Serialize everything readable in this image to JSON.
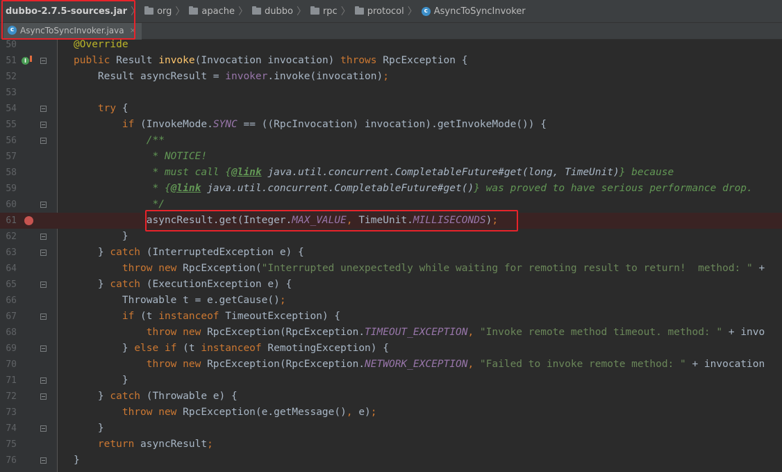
{
  "breadcrumb": {
    "items": [
      "dubbo-2.7.5-sources.jar",
      "org",
      "apache",
      "dubbo",
      "rpc",
      "protocol",
      "AsyncToSyncInvoker"
    ],
    "icons": [
      "none",
      "folder-icon",
      "folder-icon",
      "folder-icon",
      "folder-icon",
      "folder-icon",
      "class-icon"
    ]
  },
  "tab": {
    "label": "AsyncToSyncInvoker.java",
    "close": "×",
    "icon": "class-icon"
  },
  "colors": {
    "background": "#2b2b2b",
    "keyword": "#cc7832",
    "string": "#6a8759",
    "comment": "#629755",
    "field": "#9876aa",
    "method": "#ffc66d",
    "highlight_box": "#e8232a",
    "breakpoint": "#c75450"
  },
  "editor": {
    "lines": [
      {
        "n": "50",
        "html": "<span class=\"a\">@Override</span>",
        "fold": false,
        "bp": false,
        "override": false
      },
      {
        "n": "51",
        "html": "<span class=\"k\">public</span> Result <span class=\"fn\">invoke</span>(Invocation invocation) <span class=\"k\">throws</span> RpcException {",
        "fold": true,
        "bp": false,
        "override": true
      },
      {
        "n": "52",
        "html": "    Result asyncResult = <span class=\"fld\">invoker</span>.invoke(invocation)<span class=\"k\">;</span>",
        "fold": false,
        "bp": false,
        "override": false
      },
      {
        "n": "53",
        "html": "",
        "fold": false,
        "bp": false,
        "override": false
      },
      {
        "n": "54",
        "html": "    <span class=\"k\">try</span> {",
        "fold": true,
        "bp": false,
        "override": false
      },
      {
        "n": "55",
        "html": "        <span class=\"k\">if</span> (InvokeMode.<span class=\"st\">SYNC</span> == ((RpcInvocation) invocation).getInvokeMode()) {",
        "fold": true,
        "bp": false,
        "override": false
      },
      {
        "n": "56",
        "html": "            <span class=\"c\">/**</span>",
        "fold": true,
        "bp": false,
        "override": false
      },
      {
        "n": "57",
        "html": "<span class=\"c\">             * NOTICE!</span>",
        "fold": false,
        "bp": false,
        "override": false
      },
      {
        "n": "58",
        "html": "<span class=\"c\">             * must call {</span><span class=\"ct\">@link</span><span class=\"cr\"> java.util.concurrent.CompletableFuture#get(long, TimeUnit)</span><span class=\"c\">} because</span>",
        "fold": false,
        "bp": false,
        "override": false
      },
      {
        "n": "59",
        "html": "<span class=\"c\">             * {</span><span class=\"ct\">@link</span><span class=\"cr\"> java.util.concurrent.CompletableFuture#get()</span><span class=\"c\">} was proved to have serious performance drop.</span>",
        "fold": false,
        "bp": false,
        "override": false
      },
      {
        "n": "60",
        "html": "<span class=\"c\">             */</span>",
        "fold": true,
        "bp": false,
        "override": false
      },
      {
        "n": "61",
        "html": "            asyncResult.get(Integer.<span class=\"st\">MAX_VALUE</span><span class=\"k\">,</span> TimeUnit.<span class=\"st\">MILLISECONDS</span>)<span class=\"k\">;</span>",
        "fold": false,
        "bp": true,
        "override": false
      },
      {
        "n": "62",
        "html": "        }",
        "fold": true,
        "bp": false,
        "override": false
      },
      {
        "n": "63",
        "html": "    } <span class=\"k\">catch</span> (InterruptedException e) {",
        "fold": true,
        "bp": false,
        "override": false
      },
      {
        "n": "64",
        "html": "        <span class=\"k\">throw new</span> RpcException(<span class=\"s\">\"Interrupted unexpectedly while waiting for remoting result to return!  method: \"</span> +",
        "fold": false,
        "bp": false,
        "override": false
      },
      {
        "n": "65",
        "html": "    } <span class=\"k\">catch</span> (ExecutionException e) {",
        "fold": true,
        "bp": false,
        "override": false
      },
      {
        "n": "66",
        "html": "        Throwable t = e.getCause()<span class=\"k\">;</span>",
        "fold": false,
        "bp": false,
        "override": false
      },
      {
        "n": "67",
        "html": "        <span class=\"k\">if</span> (t <span class=\"k\">instanceof</span> TimeoutException) {",
        "fold": true,
        "bp": false,
        "override": false
      },
      {
        "n": "68",
        "html": "            <span class=\"k\">throw new</span> RpcException(RpcException.<span class=\"st\">TIMEOUT_EXCEPTION</span><span class=\"k\">,</span> <span class=\"s\">\"Invoke remote method timeout. method: \"</span> + invo",
        "fold": false,
        "bp": false,
        "override": false
      },
      {
        "n": "69",
        "html": "        } <span class=\"k\">else if</span> (t <span class=\"k\">instanceof</span> RemotingException) {",
        "fold": true,
        "bp": false,
        "override": false
      },
      {
        "n": "70",
        "html": "            <span class=\"k\">throw new</span> RpcException(RpcException.<span class=\"st\">NETWORK_EXCEPTION</span><span class=\"k\">,</span> <span class=\"s\">\"Failed to invoke remote method: \"</span> + invocation",
        "fold": false,
        "bp": false,
        "override": false
      },
      {
        "n": "71",
        "html": "        }",
        "fold": true,
        "bp": false,
        "override": false
      },
      {
        "n": "72",
        "html": "    } <span class=\"k\">catch</span> (Throwable e) {",
        "fold": true,
        "bp": false,
        "override": false
      },
      {
        "n": "73",
        "html": "        <span class=\"k\">throw new</span> RpcException(e.getMessage()<span class=\"k\">,</span> e)<span class=\"k\">;</span>",
        "fold": false,
        "bp": false,
        "override": false
      },
      {
        "n": "74",
        "html": "    }",
        "fold": true,
        "bp": false,
        "override": false
      },
      {
        "n": "75",
        "html": "    <span class=\"k\">return</span> asyncResult<span class=\"k\">;</span>",
        "fold": false,
        "bp": false,
        "override": false
      },
      {
        "n": "76",
        "html": "}",
        "fold": true,
        "bp": false,
        "override": false
      }
    ]
  }
}
